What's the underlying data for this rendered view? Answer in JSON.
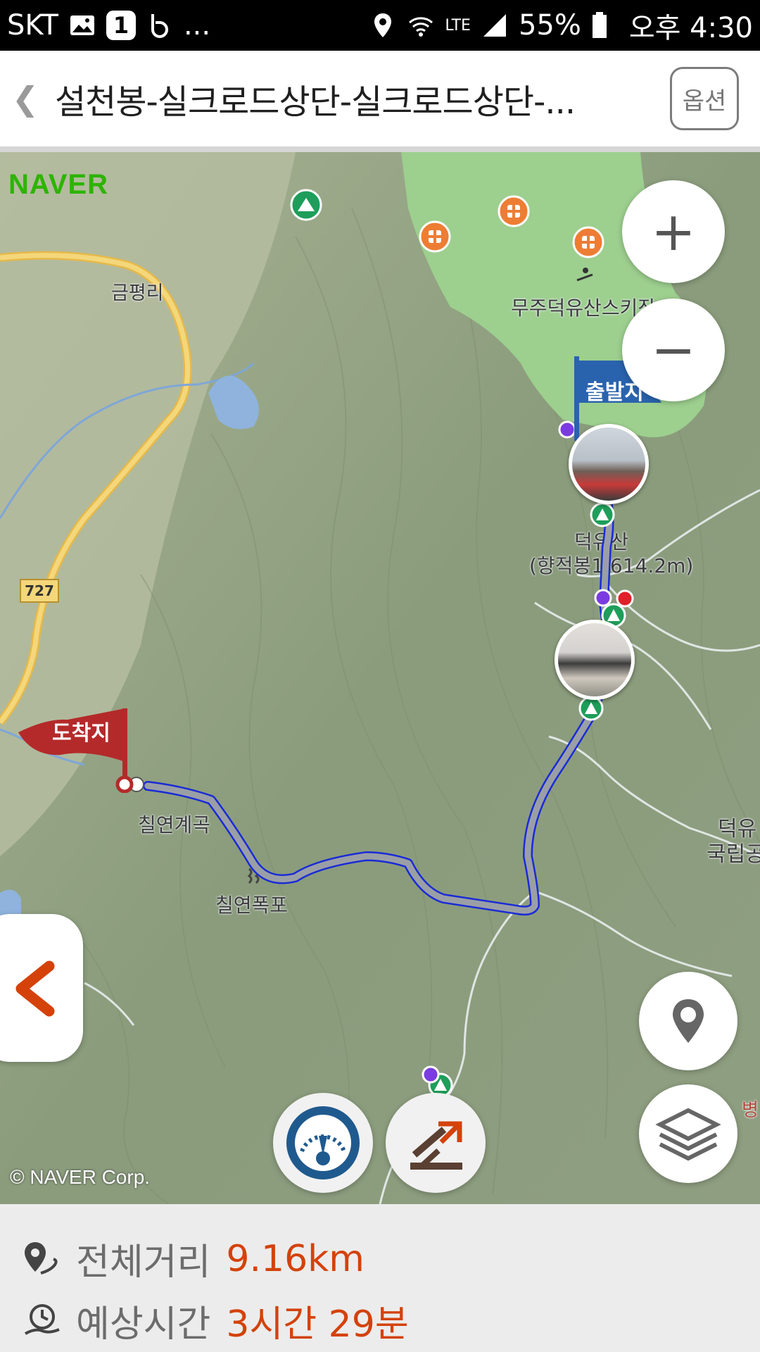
{
  "status_bar": {
    "carrier": "SKT",
    "badge": "1",
    "more": "...",
    "network": "LTE",
    "battery": "55%",
    "time": "오후 4:30"
  },
  "header": {
    "back_icon": "chevron-left-icon",
    "title": "설천봉-실크로드상단-실크로드상단-...",
    "option_label": "옵션"
  },
  "map": {
    "provider_logo": "NAVER",
    "copyright": "© NAVER Corp.",
    "labels": {
      "village": "금평리",
      "ski_resort": "무주덕유산스키장",
      "road_number": "727",
      "peak_name": "덕유산",
      "peak_detail": "(향적봉1,614.2m)",
      "valley": "칠연계곡",
      "waterfall": "칠연폭포",
      "park_partial_1": "덕유",
      "park_partial_2": "국립공",
      "right_partial": "병"
    },
    "start_flag": "출발지",
    "end_flag": "도착지",
    "route_color": "#1a2bd6",
    "park_color": "#9dcf8f"
  },
  "controls": {
    "zoom_in": "+",
    "zoom_out": "−",
    "location_icon": "map-pin-icon",
    "layers_icon": "layers-icon",
    "speed_icon": "speedometer-icon",
    "elevation_icon": "elevation-profile-icon",
    "panel_toggle_icon": "chevron-left-icon"
  },
  "summary": {
    "distance_label": "전체거리",
    "distance_value": "9.16km",
    "time_label": "예상시간",
    "time_value": "3시간 29분"
  }
}
